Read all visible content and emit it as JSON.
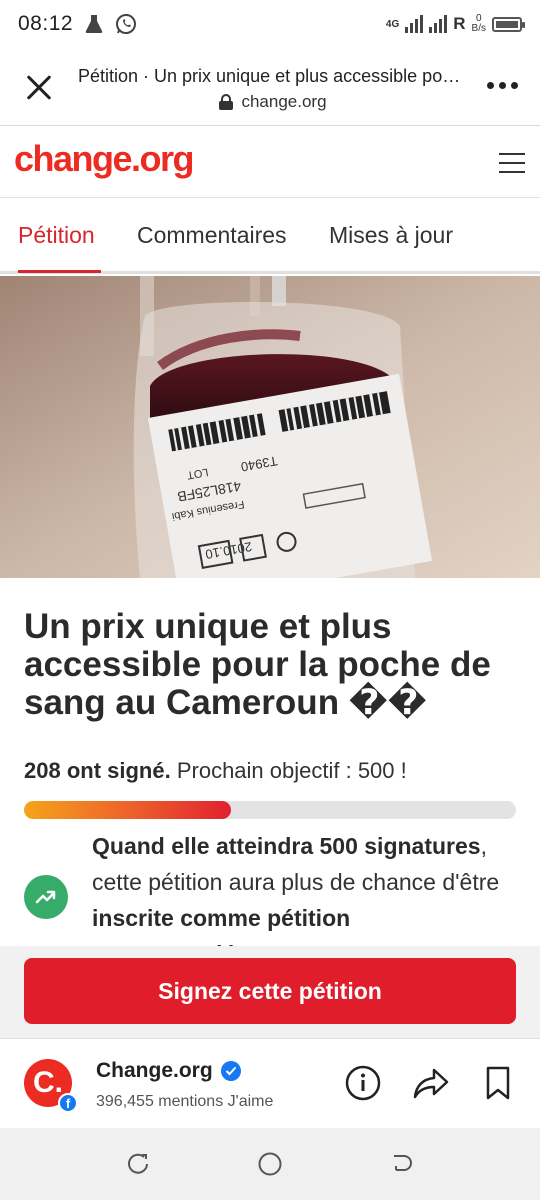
{
  "status_bar": {
    "time": "08:12",
    "network_label": "4G",
    "roaming_label": "R",
    "speed_value": "0",
    "speed_unit": "B/s",
    "icons": [
      "flask-icon",
      "whatsapp-icon",
      "signal-icon",
      "battery-icon"
    ]
  },
  "browser": {
    "page_title": "Pétition · Un prix unique et plus accessible pour la poche de sang au Cameroun",
    "url": "change.org"
  },
  "site": {
    "logo": "change.org",
    "brand_color": "#ec2c22"
  },
  "tabs": [
    {
      "label": "Pétition",
      "active": true
    },
    {
      "label": "Commentaires",
      "active": false
    },
    {
      "label": "Mises à jour",
      "active": false
    }
  ],
  "petition": {
    "title": "Un prix unique et plus accessible pour la poche de sang au Cameroun ��",
    "signed": "208 ont signé.",
    "next_goal": " Prochain objectif : 500 !",
    "progress_fraction": 0.42,
    "info_bold_1": "Quand elle atteindra 500 signatures",
    "info_text_1": ", cette pétition aura plus de chance d'être ",
    "info_bold_2": "inscrite comme pétition recommandée",
    "info_text_2": " !"
  },
  "hero": {
    "bag_labels": [
      "T3940",
      "LOT",
      "418L25FB",
      "Fresenius Kabi",
      "2010.10"
    ]
  },
  "sign_button": {
    "label": "Signez cette pétition",
    "color": "#e01d2b"
  },
  "facebook_plugin": {
    "avatar_letter": "C.",
    "badge_letter": "f",
    "page_name": "Change.org",
    "likes": "396,455 mentions J'aime"
  }
}
